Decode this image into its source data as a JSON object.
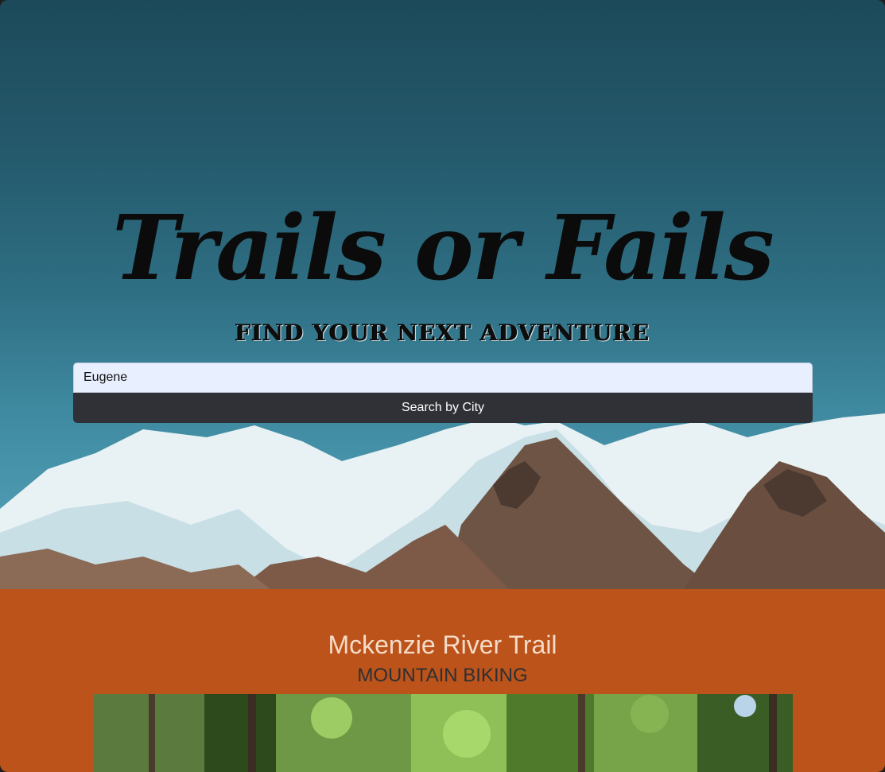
{
  "hero": {
    "title": "Trails or Fails",
    "subtitle": "FIND YOUR NEXT ADVENTURE",
    "background_image": "snowy-mountain-range"
  },
  "search": {
    "value": "Eugene",
    "button_label": "Search by City"
  },
  "results": {
    "background_color": "#bb531a",
    "trail": {
      "name": "Mckenzie River Trail",
      "type": "MOUNTAIN BIKING",
      "image": "forest-trail-photo"
    }
  }
}
